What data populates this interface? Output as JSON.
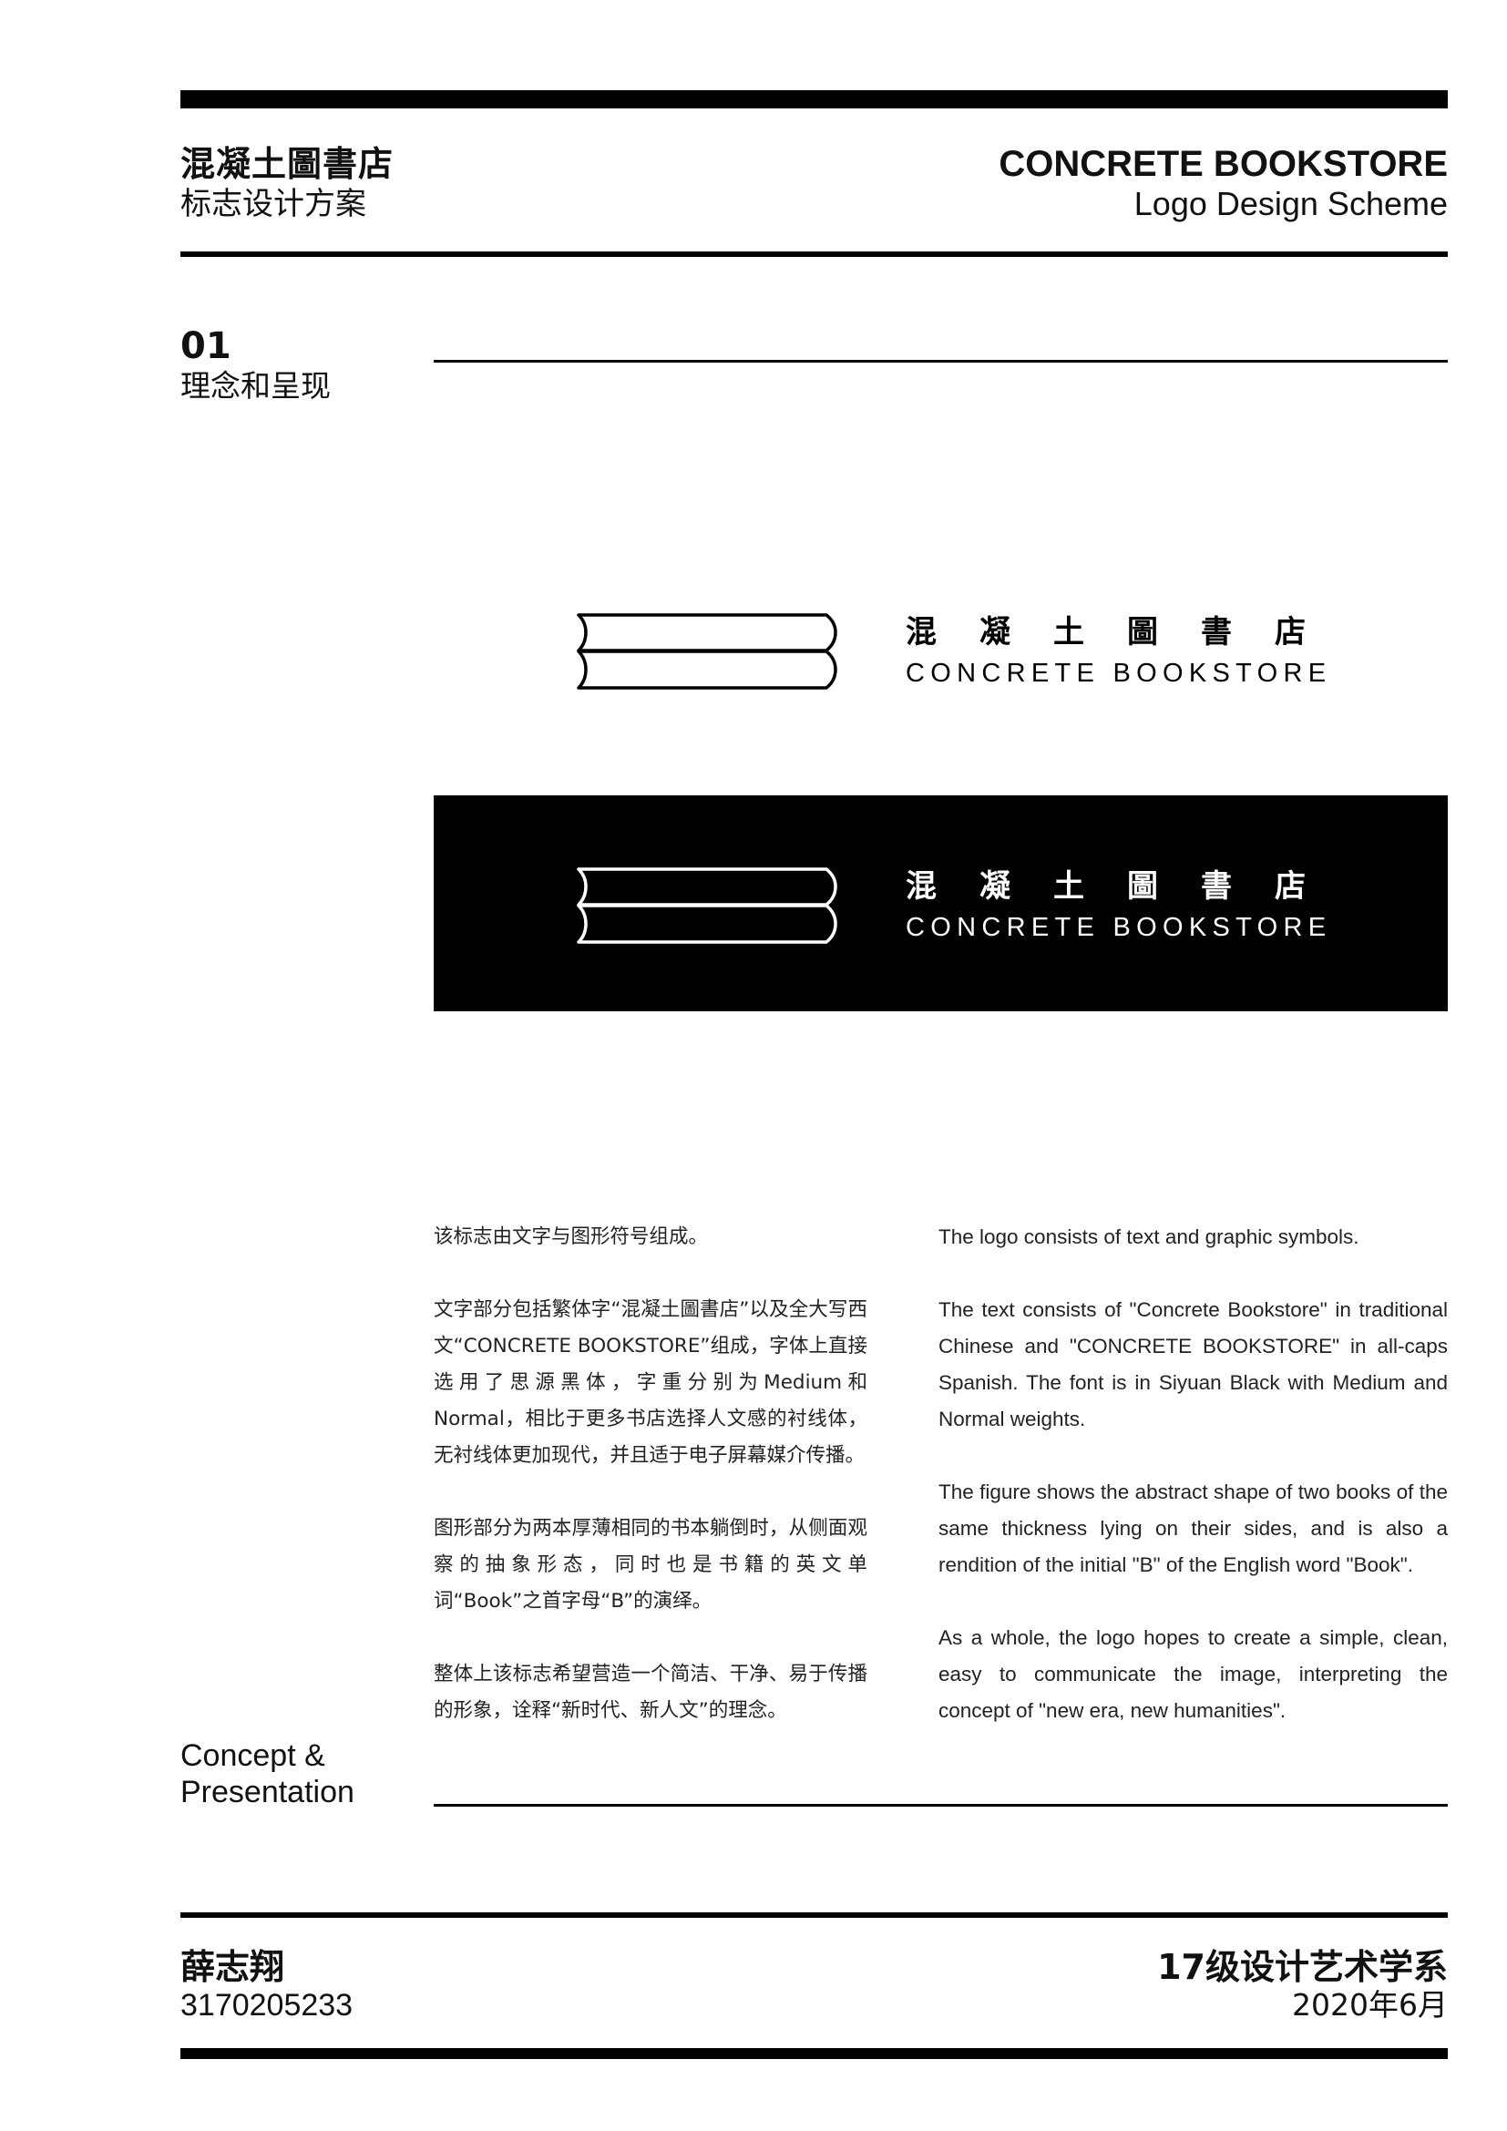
{
  "header": {
    "title_cn": "混凝土圖書店",
    "subtitle_cn": "标志设计方案",
    "title_en": "CONCRETE BOOKSTORE",
    "subtitle_en": "Logo Design Scheme"
  },
  "section": {
    "number": "01",
    "title_cn": "理念和呈现",
    "title_en_line1": "Concept &",
    "title_en_line2": "Presentation"
  },
  "logo": {
    "name_cn": "混凝土圖書店",
    "name_en": "CONCRETE BOOKSTORE",
    "icon": "two-books-icon",
    "light_color": "#000000",
    "dark_bg": "#000000",
    "dark_color": "#ffffff"
  },
  "body_cn": [
    "该标志由文字与图形符号组成。",
    "文字部分包括繁体字“混凝土圖書店”以及全大写西文“CONCRETE BOOKSTORE”组成，字体上直接选用了思源黑体，字重分别为Medium和Normal，相比于更多书店选择人文感的衬线体，无衬线体更加现代，并且适于电子屏幕媒介传播。",
    "图形部分为两本厚薄相同的书本躺倒时，从侧面观察的抽象形态，同时也是书籍的英文单词“Book”之首字母“B”的演绎。",
    "整体上该标志希望营造一个简洁、干净、易于传播的形象，诠释“新时代、新人文”的理念。"
  ],
  "body_en": [
    "The logo consists of text and graphic symbols.",
    "The text consists of \"Concrete Bookstore\" in traditional Chinese and \"CONCRETE BOOKSTORE\" in all-caps Spanish. The font is in Siyuan Black with Medium and Normal weights.",
    "The figure shows the abstract shape of two books of the same thickness lying on their sides, and is also a rendition of the initial \"B\" of the English word \"Book\".",
    "As a whole, the logo hopes to create a simple, clean, easy to communicate the image, interpreting the concept of \"new era, new humanities\"."
  ],
  "footer": {
    "author": "薛志翔",
    "student_id": "3170205233",
    "department": "17级设计艺术学系",
    "date": "2020年6月"
  }
}
